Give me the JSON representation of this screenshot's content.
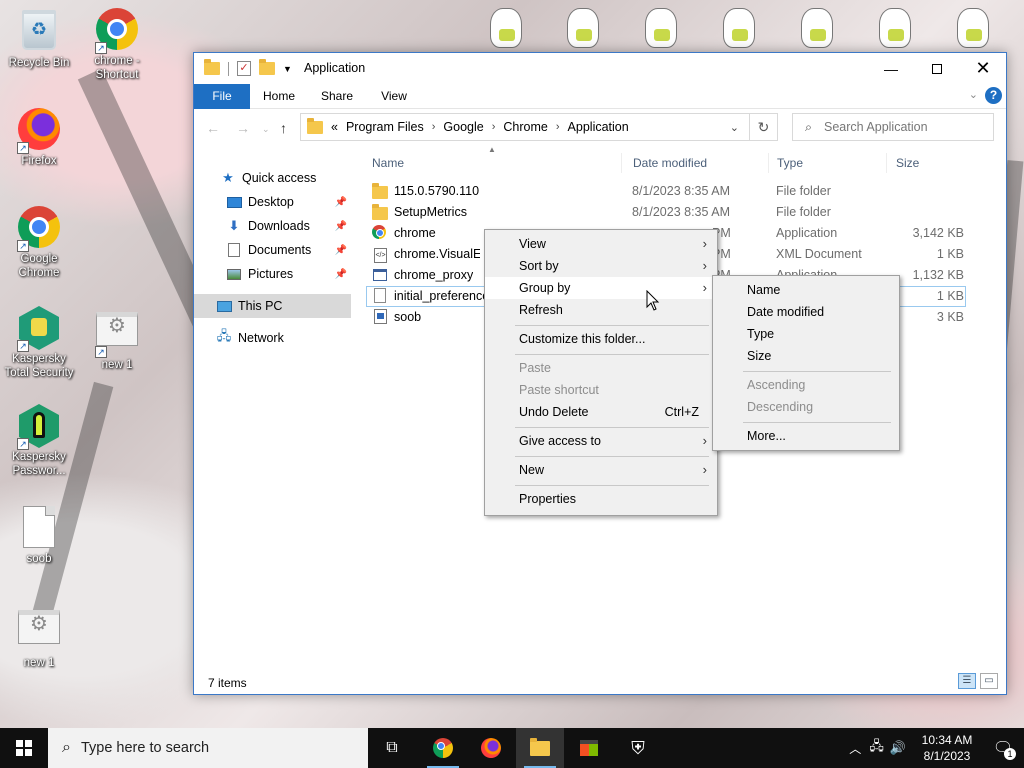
{
  "desktop": {
    "icons": [
      {
        "label": "Recycle Bin"
      },
      {
        "label": "chrome - Shortcut"
      },
      {
        "label": "Firefox"
      },
      {
        "label": "Google Chrome"
      },
      {
        "label": "Kaspersky Total Security"
      },
      {
        "label": "new 1"
      },
      {
        "label": "Kaspersky Passwor..."
      },
      {
        "label": "soob"
      },
      {
        "label": "new 1"
      }
    ]
  },
  "window": {
    "title": "Application",
    "ribbon_tabs": [
      "File",
      "Home",
      "Share",
      "View"
    ],
    "help": "?",
    "address": {
      "prefix": "«",
      "crumbs": [
        "Program Files",
        "Google",
        "Chrome",
        "Application"
      ]
    },
    "search_placeholder": "Search Application",
    "nav": {
      "quick_access": "Quick access",
      "desktop": "Desktop",
      "downloads": "Downloads",
      "documents": "Documents",
      "pictures": "Pictures",
      "this_pc": "This PC",
      "network": "Network"
    },
    "columns": {
      "name": "Name",
      "date": "Date modified",
      "type": "Type",
      "size": "Size"
    },
    "files": [
      {
        "name": "115.0.5790.110",
        "date": "8/1/2023 8:35 AM",
        "type": "File folder",
        "size": ""
      },
      {
        "name": "SetupMetrics",
        "date": "8/1/2023 8:35 AM",
        "type": "File folder",
        "size": ""
      },
      {
        "name": "chrome",
        "date": "PM",
        "type": "Application",
        "size": "3,142 KB"
      },
      {
        "name": "chrome.VisualElem",
        "date": "PM",
        "type": "XML Document",
        "size": "1 KB"
      },
      {
        "name": "chrome_proxy",
        "date": "PM",
        "type": "Application",
        "size": "1,132 KB"
      },
      {
        "name": "initial_preferences",
        "date": "",
        "type": "",
        "size": "1 KB"
      },
      {
        "name": "soob",
        "date": "",
        "type": "",
        "size": "3 KB"
      }
    ],
    "status": "7 items"
  },
  "context_menu": {
    "view": "View",
    "sort_by": "Sort by",
    "group_by": "Group by",
    "refresh": "Refresh",
    "customize": "Customize this folder...",
    "paste": "Paste",
    "paste_shortcut": "Paste shortcut",
    "undo_delete": "Undo Delete",
    "undo_shortcut": "Ctrl+Z",
    "give_access": "Give access to",
    "new": "New",
    "properties": "Properties"
  },
  "group_submenu": {
    "name": "Name",
    "date_modified": "Date modified",
    "type": "Type",
    "size": "Size",
    "ascending": "Ascending",
    "descending": "Descending",
    "more": "More..."
  },
  "taskbar": {
    "search_placeholder": "Type here to search",
    "time": "10:34 AM",
    "date": "8/1/2023",
    "notification_count": "1"
  }
}
